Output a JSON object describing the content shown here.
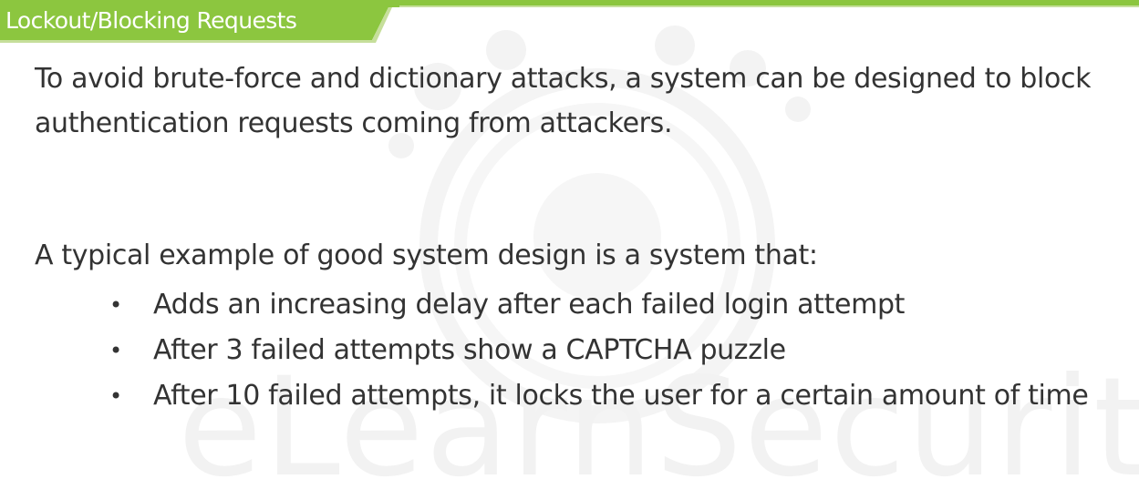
{
  "slide": {
    "title": "Lockout/Blocking Requests",
    "watermark": "eLearnSecurity",
    "colors": {
      "accent": "#8cc63f",
      "text": "#333333",
      "watermark": "#f2f2f2"
    },
    "body": {
      "intro": "To avoid brute-force and dictionary attacks, a system can be designed to block authentication requests coming from attackers.",
      "lead": "A typical example of good system design is a system that:",
      "bullets": [
        "Adds an increasing delay after each failed login attempt",
        "After 3 failed attempts show a CAPTCHA puzzle",
        "After 10 failed attempts, it locks the user for a certain amount of time"
      ],
      "bullet_symbol": "•"
    }
  }
}
